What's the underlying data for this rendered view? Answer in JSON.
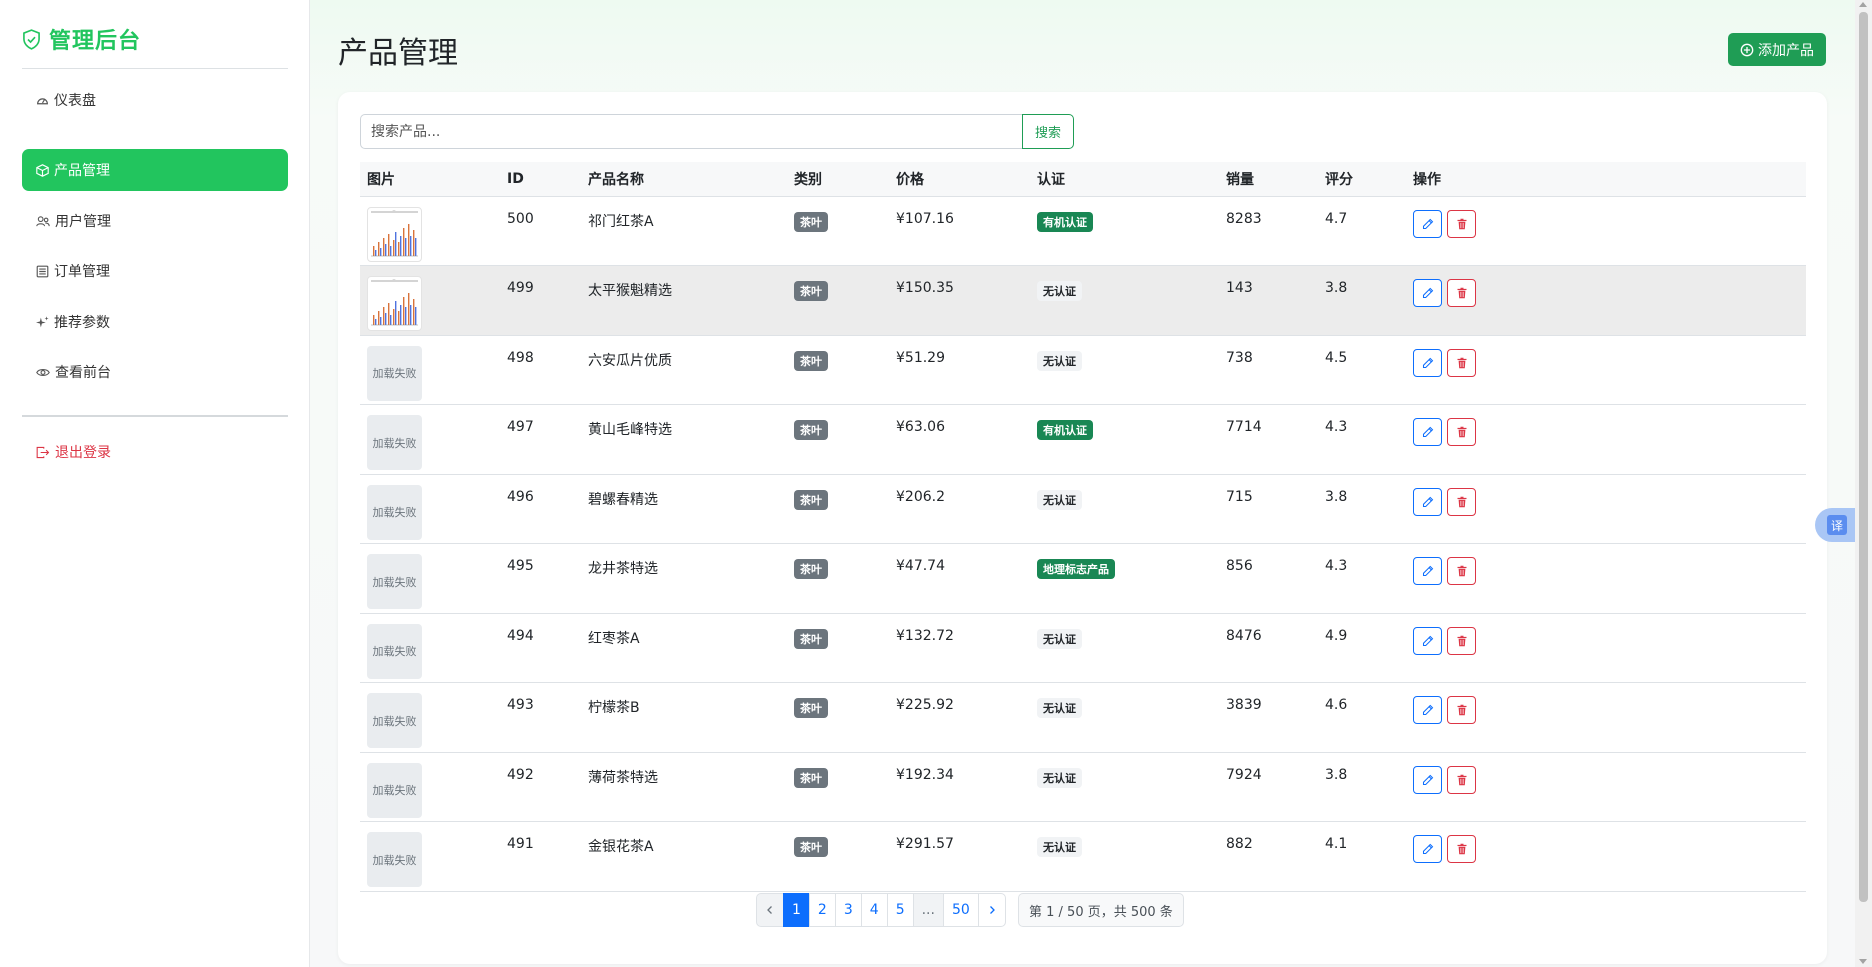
{
  "app": {
    "brand": "管理后台"
  },
  "sidebar": {
    "items": [
      {
        "label": "仪表盘",
        "icon": "speedometer-icon",
        "active": false
      },
      {
        "label": "产品管理",
        "icon": "box-icon",
        "active": true
      },
      {
        "label": "用户管理",
        "icon": "people-icon",
        "active": false
      },
      {
        "label": "订单管理",
        "icon": "list-icon",
        "active": false
      },
      {
        "label": "推荐参数",
        "icon": "stars-icon",
        "active": false
      },
      {
        "label": "查看前台",
        "icon": "eye-icon",
        "active": false
      }
    ],
    "logout_label": "退出登录"
  },
  "header": {
    "title": "产品管理",
    "add_label": "添加产品"
  },
  "search": {
    "placeholder": "搜索产品...",
    "button_label": "搜索"
  },
  "table": {
    "columns": [
      "图片",
      "ID",
      "产品名称",
      "类别",
      "价格",
      "认证",
      "销量",
      "评分",
      "操作"
    ],
    "image_failed_text": "加载失败",
    "rows": [
      {
        "image": "chart",
        "id": "500",
        "name": "祁门红茶A",
        "category": "茶叶",
        "price": "¥107.16",
        "cert": "有机认证",
        "cert_style": "green",
        "sales": "8283",
        "rating": "4.7"
      },
      {
        "image": "chart",
        "id": "499",
        "name": "太平猴魁精选",
        "category": "茶叶",
        "price": "¥150.35",
        "cert": "无认证",
        "cert_style": "none",
        "sales": "143",
        "rating": "3.8",
        "highlight": true
      },
      {
        "image": "failed",
        "id": "498",
        "name": "六安瓜片优质",
        "category": "茶叶",
        "price": "¥51.29",
        "cert": "无认证",
        "cert_style": "none",
        "sales": "738",
        "rating": "4.5"
      },
      {
        "image": "failed",
        "id": "497",
        "name": "黄山毛峰特选",
        "category": "茶叶",
        "price": "¥63.06",
        "cert": "有机认证",
        "cert_style": "green",
        "sales": "7714",
        "rating": "4.3"
      },
      {
        "image": "failed",
        "id": "496",
        "name": "碧螺春精选",
        "category": "茶叶",
        "price": "¥206.2",
        "cert": "无认证",
        "cert_style": "none",
        "sales": "715",
        "rating": "3.8"
      },
      {
        "image": "failed",
        "id": "495",
        "name": "龙井茶特选",
        "category": "茶叶",
        "price": "¥47.74",
        "cert": "地理标志产品",
        "cert_style": "green",
        "sales": "856",
        "rating": "4.3"
      },
      {
        "image": "failed",
        "id": "494",
        "name": "红枣茶A",
        "category": "茶叶",
        "price": "¥132.72",
        "cert": "无认证",
        "cert_style": "none",
        "sales": "8476",
        "rating": "4.9"
      },
      {
        "image": "failed",
        "id": "493",
        "name": "柠檬茶B",
        "category": "茶叶",
        "price": "¥225.92",
        "cert": "无认证",
        "cert_style": "none",
        "sales": "3839",
        "rating": "4.6"
      },
      {
        "image": "failed",
        "id": "492",
        "name": "薄荷茶特选",
        "category": "茶叶",
        "price": "¥192.34",
        "cert": "无认证",
        "cert_style": "none",
        "sales": "7924",
        "rating": "3.8"
      },
      {
        "image": "failed",
        "id": "491",
        "name": "金银花茶A",
        "category": "茶叶",
        "price": "¥291.57",
        "cert": "无认证",
        "cert_style": "none",
        "sales": "882",
        "rating": "4.1"
      }
    ]
  },
  "pagination": {
    "pages": [
      "1",
      "2",
      "3",
      "4",
      "5",
      "...",
      "50"
    ],
    "current": "1",
    "info": "第 1 / 50 页，共 500 条"
  },
  "translate_widget": {
    "label": "译"
  },
  "colors": {
    "brand": "#22c55e",
    "primary": "#0d6efd",
    "danger": "#dc3545",
    "success": "#198754",
    "secondary": "#6c757d"
  }
}
